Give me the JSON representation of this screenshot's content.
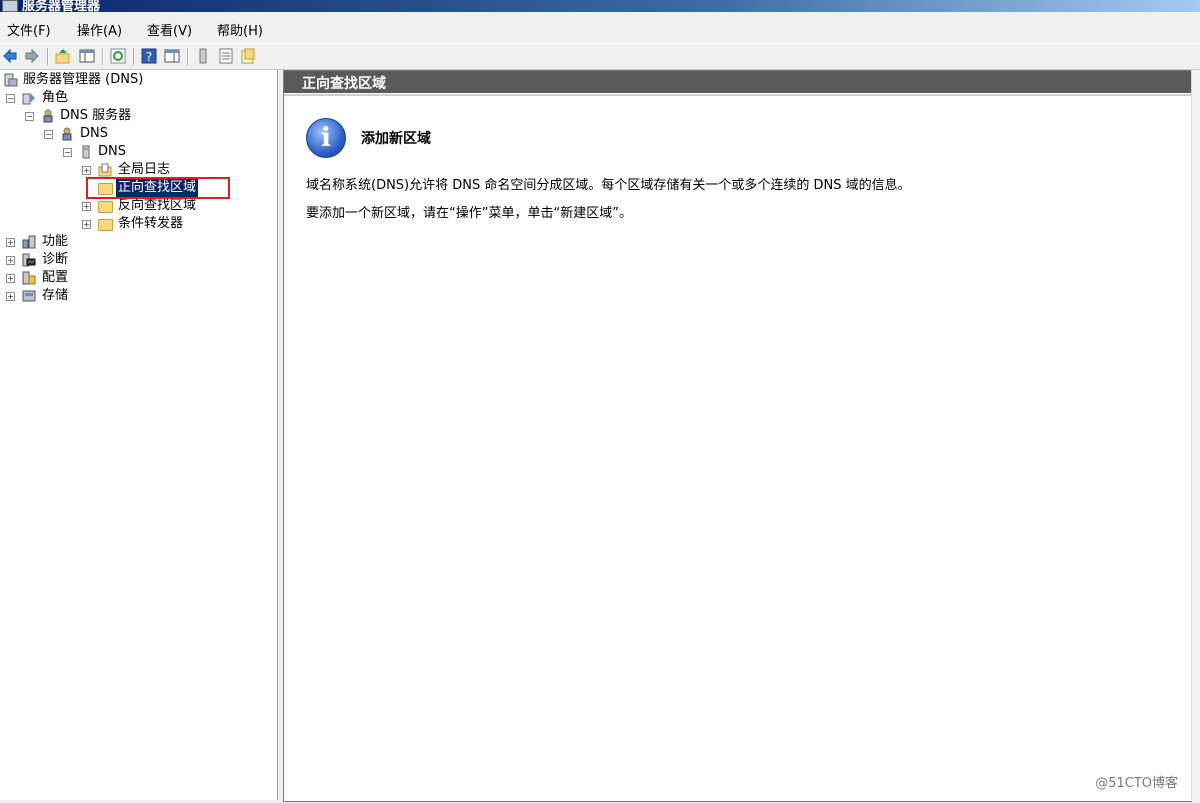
{
  "window": {
    "title": "服务器管理器"
  },
  "menu": [
    "文件(F)",
    "操作(A)",
    "查看(V)",
    "帮助(H)"
  ],
  "toolbar": {
    "icons": [
      "back-icon",
      "forward-icon",
      "up-icon",
      "show-hide-tree-icon",
      "refresh-icon",
      "help-icon",
      "properties-icon",
      "server-icon",
      "list-icon",
      "export-icon"
    ]
  },
  "tree": {
    "root": "服务器管理器 (DNS)",
    "roles": "角色",
    "dns_server": "DNS 服务器",
    "dns_group": "DNS",
    "dns_host": "DNS",
    "global_logs": "全局日志",
    "forward_zone": "正向查找区域",
    "reverse_zone": "反向查找区域",
    "conditional_forwarders": "条件转发器",
    "features": "功能",
    "diagnostics": "诊断",
    "configuration": "配置",
    "storage": "存储"
  },
  "detail": {
    "header": "正向查找区域",
    "title": "添加新区域",
    "paragraph1": "域名称系统(DNS)允许将 DNS 命名空间分成区域。每个区域存储有关一个或多个连续的 DNS 域的信息。",
    "paragraph2": "要添加一个新区域，请在“操作”菜单，单击“新建区域”。"
  },
  "watermark": "@51CTO博客",
  "colors": {
    "highlight_box": "#e02020",
    "selection": "#0a246a",
    "header_bg": "#5a5a5a"
  }
}
